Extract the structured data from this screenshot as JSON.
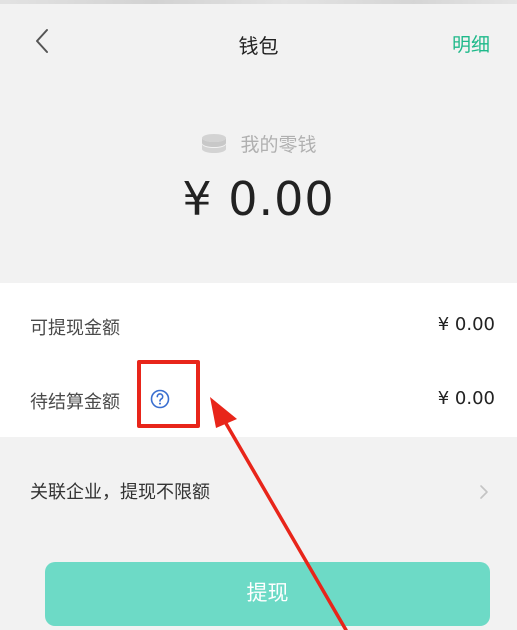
{
  "header": {
    "title": "钱包",
    "detail_label": "明细"
  },
  "balance": {
    "label": "我的零钱",
    "amount": "¥ 0.00"
  },
  "rows": [
    {
      "label": "可提现金额",
      "value": "¥ 0.00"
    },
    {
      "label": "待结算金额",
      "value": "¥ 0.00"
    }
  ],
  "enterprise": {
    "label": "关联企业，提现不限额"
  },
  "withdraw": {
    "label": "提现"
  },
  "colors": {
    "accent": "#1fb98a",
    "button": "#6ddac6",
    "annotation": "#e8251a"
  },
  "icons": {
    "back": "chevron-left-icon",
    "coin": "coin-stack-icon",
    "help": "question-circle-icon",
    "chevron": "chevron-right-icon"
  }
}
